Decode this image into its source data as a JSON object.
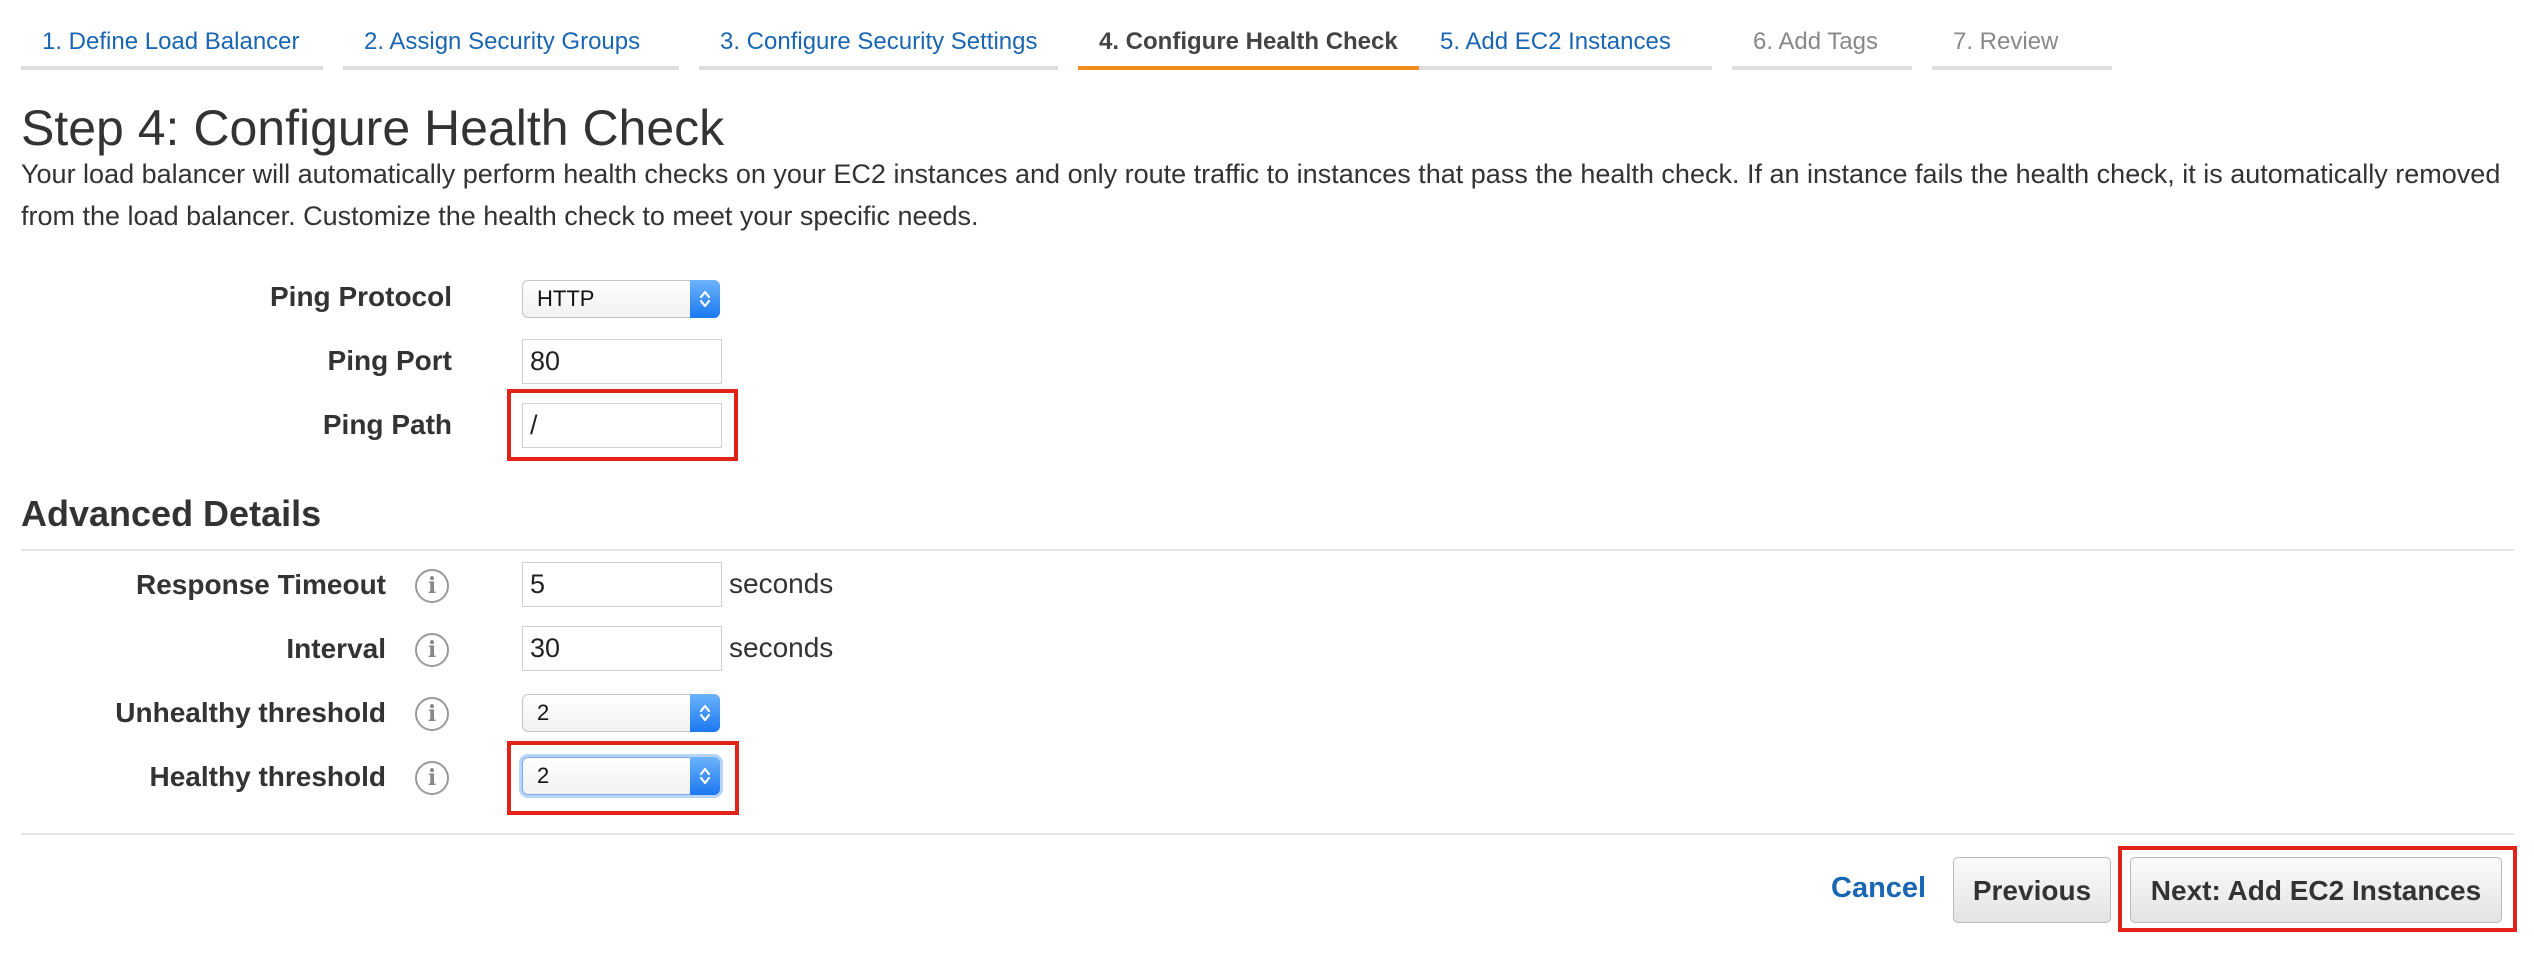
{
  "wizard": {
    "steps": [
      {
        "label": "1. Define Load Balancer"
      },
      {
        "label": "2. Assign Security Groups"
      },
      {
        "label": "3. Configure Security Settings"
      },
      {
        "label": "4. Configure Health Check"
      },
      {
        "label": "5. Add EC2 Instances"
      },
      {
        "label": "6. Add Tags"
      },
      {
        "label": "7. Review"
      }
    ]
  },
  "page": {
    "title": "Step 4: Configure Health Check",
    "description": "Your load balancer will automatically perform health checks on your EC2 instances and only route traffic to instances that pass the health check. If an instance fails the health check, it is automatically removed from the load balancer. Customize the health check to meet your specific needs."
  },
  "ping": {
    "protocol_label": "Ping Protocol",
    "protocol_value": "HTTP",
    "port_label": "Ping Port",
    "port_value": "80",
    "path_label": "Ping Path",
    "path_value": "/"
  },
  "advanced": {
    "title": "Advanced Details",
    "response_timeout_label": "Response Timeout",
    "response_timeout_value": "5",
    "interval_label": "Interval",
    "interval_value": "30",
    "unhealthy_label": "Unhealthy threshold",
    "unhealthy_value": "2",
    "healthy_label": "Healthy threshold",
    "healthy_value": "2",
    "unit_seconds": "seconds"
  },
  "footer": {
    "cancel_label": "Cancel",
    "previous_label": "Previous",
    "next_label": "Next: Add EC2 Instances"
  },
  "colors": {
    "link": "#1a66b3",
    "active_step_underline": "#f18c1f",
    "highlight_box": "#e2231a",
    "select_arrow": "#1a78f1"
  },
  "icons": {
    "info": "info-icon",
    "select_arrows": "chevron-up-down-icon"
  }
}
